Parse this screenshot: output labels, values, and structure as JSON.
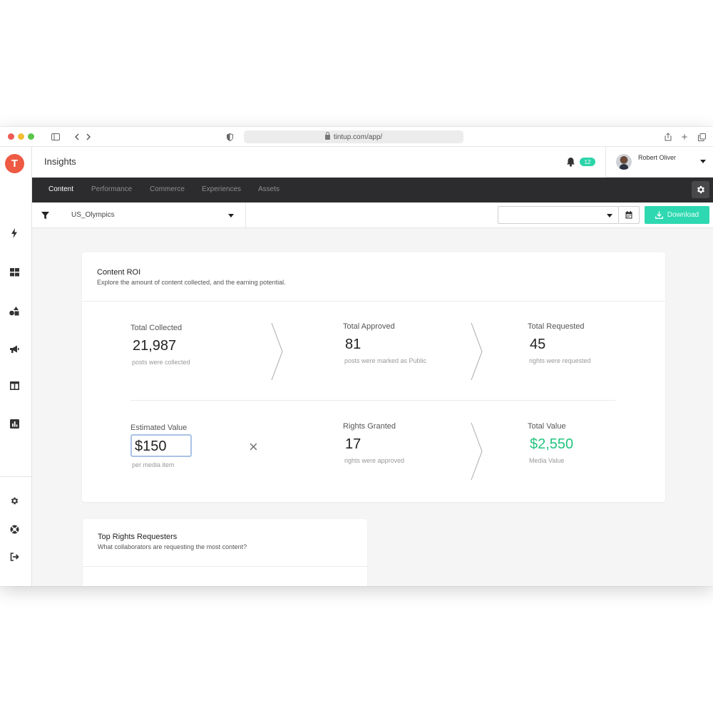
{
  "browser": {
    "url": "tintup.com/app/"
  },
  "brand": {
    "logo_letter": "T",
    "accent": "#2ed8b0",
    "logo_color": "#ee5a43"
  },
  "header": {
    "title": "Insights",
    "notification_count": "12",
    "user_name": "Robert Oliver"
  },
  "nav": {
    "tabs": [
      "Content",
      "Performance",
      "Commerce",
      "Experiences",
      "Assets"
    ],
    "active": "Content"
  },
  "filters": {
    "collection": "US_Olympics",
    "date_range": "",
    "download_label": "Download"
  },
  "roi": {
    "title": "Content ROI",
    "subtitle": "Explore the amount of content collected, and the earning potential.",
    "total_collected": {
      "label": "Total Collected",
      "value": "21,987",
      "desc": "posts were collected"
    },
    "total_approved": {
      "label": "Total Approved",
      "value": "81",
      "desc": "posts were marked as Public"
    },
    "total_requested": {
      "label": "Total Requested",
      "value": "45",
      "desc": "rights were requested"
    },
    "estimated_value": {
      "label": "Estimated Value",
      "value": "$150",
      "desc": "per media item"
    },
    "rights_granted": {
      "label": "Rights Granted",
      "value": "17",
      "desc": "rights were approved"
    },
    "total_value": {
      "label": "Total Value",
      "value": "$2,550",
      "desc": "Media Value",
      "color": "#22c47e"
    },
    "operator": "×"
  },
  "requesters": {
    "title": "Top Rights Requesters",
    "subtitle": "What collaborators are requesting the most content?"
  },
  "icons": {
    "rail": [
      "bolt-icon",
      "grid-icon",
      "shapes-icon",
      "megaphone-icon",
      "columns-icon",
      "chart-icon",
      "gear-icon",
      "lifebuoy-icon",
      "logout-icon"
    ]
  }
}
